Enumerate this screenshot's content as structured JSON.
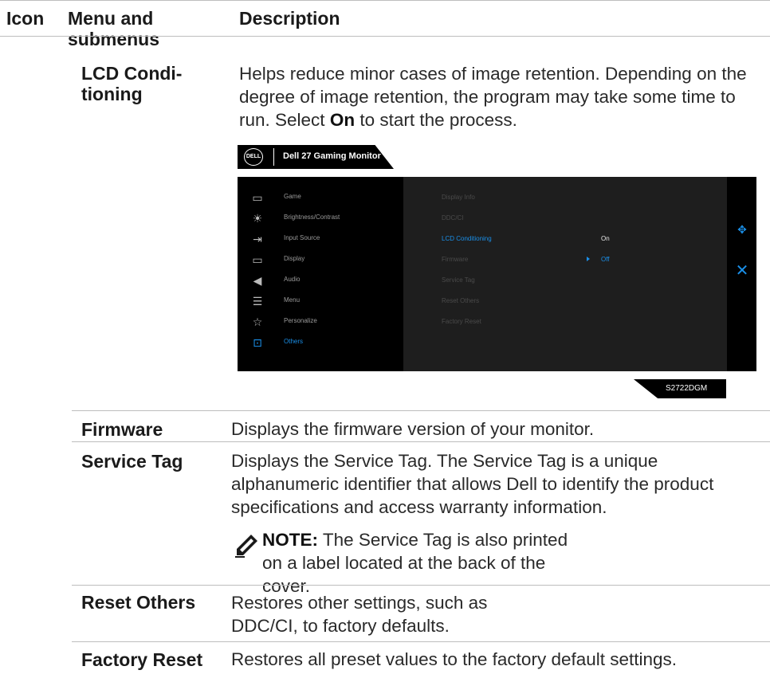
{
  "header": {
    "icon": "Icon",
    "menu": "Menu and submenus",
    "description": "Description"
  },
  "rows": {
    "lcd": {
      "name": "LCD Condi-\ntioning",
      "desc_pre": "Helps reduce minor cases of image retention. Depending on the degree of image retention, the program may take some time to run. Select ",
      "desc_bold": "On",
      "desc_post": " to start the process."
    },
    "firmware": {
      "name": "Firmware",
      "desc": "Displays the firmware version of your monitor."
    },
    "service_tag": {
      "name": "Service Tag",
      "desc": "Displays the Service Tag. The Service Tag is a unique alphanumeric identifier that allows Dell to identify the product specifications and access warranty information.",
      "note_label": "NOTE:",
      "note_text": " The Service Tag is also printed on a label located at the back of the cover."
    },
    "reset_others": {
      "name": "Reset Others",
      "desc": "Restores other settings, such as DDC/CI, to factory defaults."
    },
    "factory_reset": {
      "name": "Factory Reset",
      "desc": "Restores all preset values to the factory default settings."
    }
  },
  "osd": {
    "logo": "DELL",
    "title": "Dell 27 Gaming Monitor",
    "menu": [
      {
        "label": "Game",
        "icon": "game-icon",
        "active": false
      },
      {
        "label": "Brightness/Contrast",
        "icon": "brightness-icon",
        "active": false
      },
      {
        "label": "Input Source",
        "icon": "input-source-icon",
        "active": false
      },
      {
        "label": "Display",
        "icon": "display-icon",
        "active": false
      },
      {
        "label": "Audio",
        "icon": "audio-icon",
        "active": false
      },
      {
        "label": "Menu",
        "icon": "menu-icon",
        "active": false
      },
      {
        "label": "Personalize",
        "icon": "star-icon",
        "active": false
      },
      {
        "label": "Others",
        "icon": "others-icon",
        "active": true
      }
    ],
    "submenu": [
      {
        "label": "Display Info",
        "active": false
      },
      {
        "label": "DDC/CI",
        "active": false
      },
      {
        "label": "LCD Conditioning",
        "active": true
      },
      {
        "label": "Firmware",
        "active": false
      },
      {
        "label": "Service Tag",
        "active": false
      },
      {
        "label": "Reset Others",
        "active": false
      },
      {
        "label": "Factory Reset",
        "active": false
      }
    ],
    "value_on": "On",
    "value_off": "Off",
    "model": "S2722DGM",
    "accent_color": "#1a8fe8"
  }
}
